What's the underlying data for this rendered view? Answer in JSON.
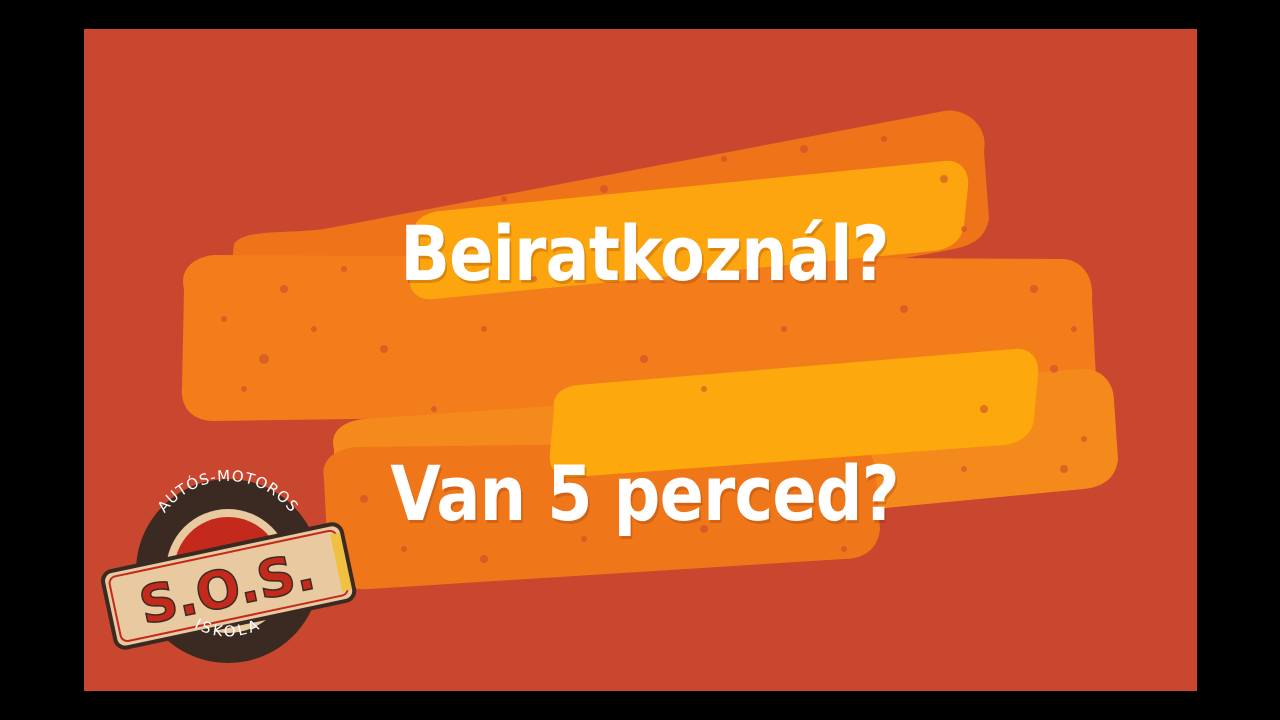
{
  "slide": {
    "line1": "Beiratkoznál?",
    "line2": "Van 5 perced?"
  },
  "logo": {
    "top_text": "AUTÓS-MOTOROS",
    "main_text": "S.O.S.",
    "bottom_text": "ISKOLA"
  },
  "colors": {
    "background": "#c8472e",
    "brush_dark": "#ee7016",
    "brush_mid": "#f7891a",
    "brush_light": "#fba20c",
    "text": "#ffffff",
    "logo_red": "#c42a1c",
    "logo_dark": "#3a2a22",
    "logo_plate": "#e8c9a0"
  }
}
